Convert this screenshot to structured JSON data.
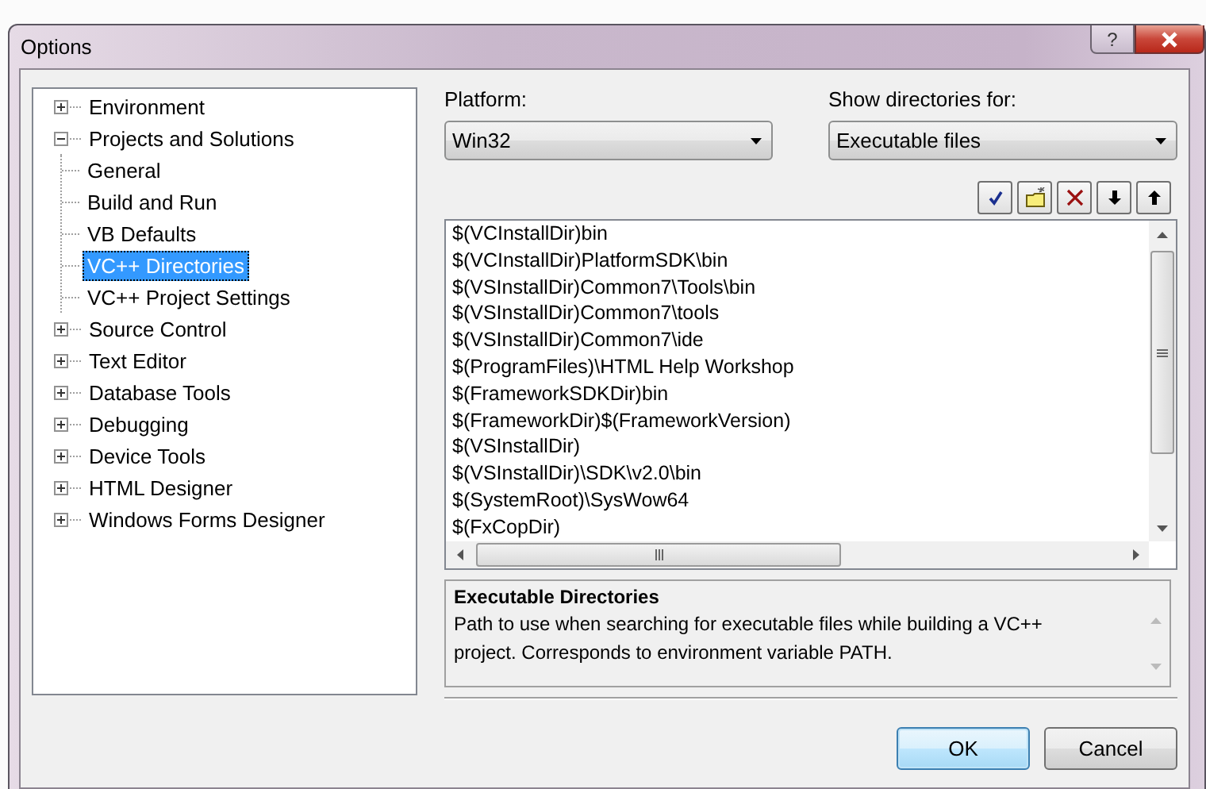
{
  "window": {
    "title": "Options",
    "help_button": "?"
  },
  "tree": [
    {
      "label": "Environment",
      "expanded": false,
      "selected": false
    },
    {
      "label": "Projects and Solutions",
      "expanded": true,
      "selected": false,
      "children": [
        {
          "label": "General",
          "selected": false
        },
        {
          "label": "Build and Run",
          "selected": false
        },
        {
          "label": "VB Defaults",
          "selected": false
        },
        {
          "label": "VC++ Directories",
          "selected": true
        },
        {
          "label": "VC++ Project Settings",
          "selected": false
        }
      ]
    },
    {
      "label": "Source Control",
      "expanded": false,
      "selected": false
    },
    {
      "label": "Text Editor",
      "expanded": false,
      "selected": false
    },
    {
      "label": "Database Tools",
      "expanded": false,
      "selected": false
    },
    {
      "label": "Debugging",
      "expanded": false,
      "selected": false
    },
    {
      "label": "Device Tools",
      "expanded": false,
      "selected": false
    },
    {
      "label": "HTML Designer",
      "expanded": false,
      "selected": false
    },
    {
      "label": "Windows Forms Designer",
      "expanded": false,
      "selected": false
    }
  ],
  "platform": {
    "label": "Platform:",
    "value": "Win32"
  },
  "show_directories_for": {
    "label": "Show directories for:",
    "value": "Executable files"
  },
  "toolbar": [
    {
      "kind": "check"
    },
    {
      "kind": "new-folder"
    },
    {
      "kind": "delete"
    },
    {
      "kind": "down"
    },
    {
      "kind": "up"
    }
  ],
  "directories": [
    "$(VCInstallDir)bin",
    "$(VCInstallDir)PlatformSDK\\bin",
    "$(VSInstallDir)Common7\\Tools\\bin",
    "$(VSInstallDir)Common7\\tools",
    "$(VSInstallDir)Common7\\ide",
    "$(ProgramFiles)\\HTML Help Workshop",
    "$(FrameworkSDKDir)bin",
    "$(FrameworkDir)$(FrameworkVersion)",
    "$(VSInstallDir)",
    "$(VSInstallDir)\\SDK\\v2.0\\bin",
    "$(SystemRoot)\\SysWow64",
    "$(FxCopDir)"
  ],
  "description": {
    "title": "Executable Directories",
    "text": "Path to use when searching for executable files while building a VC++ project.  Corresponds to environment variable PATH."
  },
  "buttons": [
    {
      "label": "OK",
      "default": true
    },
    {
      "label": "Cancel",
      "default": false
    }
  ]
}
